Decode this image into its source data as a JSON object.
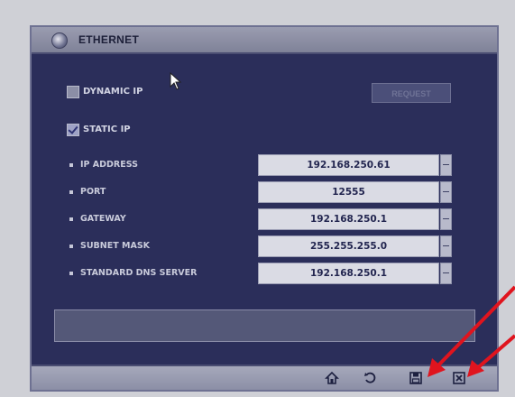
{
  "window": {
    "title": "ETHERNET"
  },
  "options": {
    "dynamic_ip": {
      "label": "DYNAMIC IP",
      "checked": false
    },
    "static_ip": {
      "label": "STATIC IP",
      "checked": true
    },
    "request_button": "REQUEST"
  },
  "fields": [
    {
      "label": "IP ADDRESS",
      "value": "192.168.250.61"
    },
    {
      "label": "PORT",
      "value": "12555"
    },
    {
      "label": "GATEWAY",
      "value": "192.168.250.1"
    },
    {
      "label": "SUBNET MASK",
      "value": "255.255.255.0"
    },
    {
      "label": "STANDARD DNS SERVER",
      "value": "192.168.250.1"
    }
  ],
  "message": "",
  "toolbar": {
    "icons": [
      "home-icon",
      "undo-icon",
      "save-icon",
      "close-icon"
    ]
  },
  "colors": {
    "panel": "#2b2e5a",
    "titlebar": "#8c8fa6",
    "field": "#dadbe4",
    "annotation_arrow": "#e0141e"
  }
}
